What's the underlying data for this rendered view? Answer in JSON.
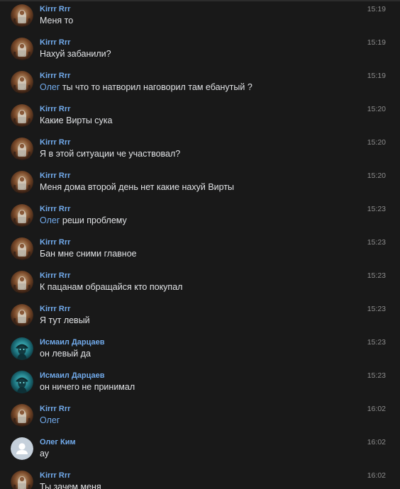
{
  "colors": {
    "background": "#191919",
    "author_name": "#71aaeb",
    "message_text": "#e1e3e6",
    "time": "#8d8d8d"
  },
  "messages": [
    {
      "author": "Kirrr Rrr",
      "avatar": "kirrr-avatar",
      "time": "15:19",
      "mention": "",
      "text": "Меня то"
    },
    {
      "author": "Kirrr Rrr",
      "avatar": "kirrr-avatar",
      "time": "15:19",
      "mention": "",
      "text": "Нахуй забанили?"
    },
    {
      "author": "Kirrr Rrr",
      "avatar": "kirrr-avatar",
      "time": "15:19",
      "mention": "Олег",
      "text": "ты что то натворил наговорил там ебанутый ?"
    },
    {
      "author": "Kirrr Rrr",
      "avatar": "kirrr-avatar",
      "time": "15:20",
      "mention": "",
      "text": "Какие Вирты сука"
    },
    {
      "author": "Kirrr Rrr",
      "avatar": "kirrr-avatar",
      "time": "15:20",
      "mention": "",
      "text": "Я в этой ситуации че участвовал?"
    },
    {
      "author": "Kirrr Rrr",
      "avatar": "kirrr-avatar",
      "time": "15:20",
      "mention": "",
      "text": "Меня дома второй день нет какие нахуй Вирты"
    },
    {
      "author": "Kirrr Rrr",
      "avatar": "kirrr-avatar",
      "time": "15:23",
      "mention": "Олег",
      "text": "реши проблему"
    },
    {
      "author": "Kirrr Rrr",
      "avatar": "kirrr-avatar",
      "time": "15:23",
      "mention": "",
      "text": "Бан мне сними главное"
    },
    {
      "author": "Kirrr Rrr",
      "avatar": "kirrr-avatar",
      "time": "15:23",
      "mention": "",
      "text": "К пацанам обращайся кто покупал"
    },
    {
      "author": "Kirrr Rrr",
      "avatar": "kirrr-avatar",
      "time": "15:23",
      "mention": "",
      "text": "Я тут левый"
    },
    {
      "author": "Исмаил Дарцаев",
      "avatar": "ismail-avatar",
      "time": "15:23",
      "mention": "",
      "text": "он левый да"
    },
    {
      "author": "Исмаил Дарцаев",
      "avatar": "ismail-avatar",
      "time": "15:23",
      "mention": "",
      "text": "он ничего не принимал"
    },
    {
      "author": "Kirrr Rrr",
      "avatar": "kirrr-avatar",
      "time": "16:02",
      "mention": "Олег",
      "text": ""
    },
    {
      "author": "Олег Ким",
      "avatar": "default-user-avatar",
      "time": "16:02",
      "mention": "",
      "text": "ау"
    },
    {
      "author": "Kirrr Rrr",
      "avatar": "kirrr-avatar",
      "time": "16:02",
      "mention": "",
      "text": "Ты зачем меня"
    }
  ]
}
